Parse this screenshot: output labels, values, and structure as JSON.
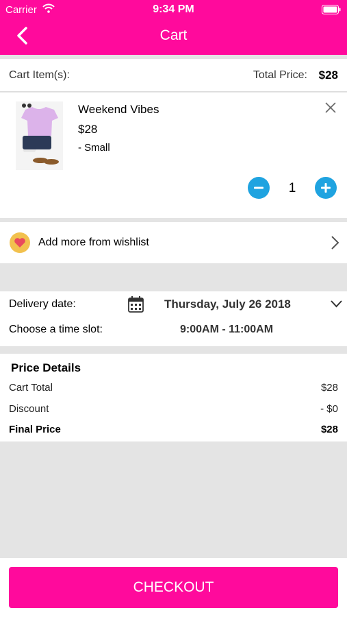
{
  "status_bar": {
    "carrier": "Carrier",
    "time": "9:34 PM"
  },
  "header": {
    "title": "Cart"
  },
  "summary": {
    "items_label": "Cart Item(s):",
    "total_label": "Total Price:",
    "total_value": "$28"
  },
  "item": {
    "name": "Weekend Vibes",
    "price": "$28",
    "size": "- Small",
    "quantity": "1"
  },
  "wishlist": {
    "label": "Add more from wishlist"
  },
  "delivery": {
    "date_label": "Delivery date:",
    "date_value": "Thursday, July 26 2018",
    "slot_label": "Choose a time slot:",
    "slot_value": "9:00AM - 11:00AM"
  },
  "price_details": {
    "heading": "Price Details",
    "rows": [
      {
        "label": "Cart Total",
        "value": "$28"
      },
      {
        "label": "Discount",
        "value": "- $0"
      },
      {
        "label": "Final Price",
        "value": "$28"
      }
    ]
  },
  "checkout": {
    "label": "CHECKOUT"
  },
  "colors": {
    "brand": "#ff0a9c",
    "accent": "#1fa3e0",
    "wishlist_badge": "#f2c14e"
  }
}
